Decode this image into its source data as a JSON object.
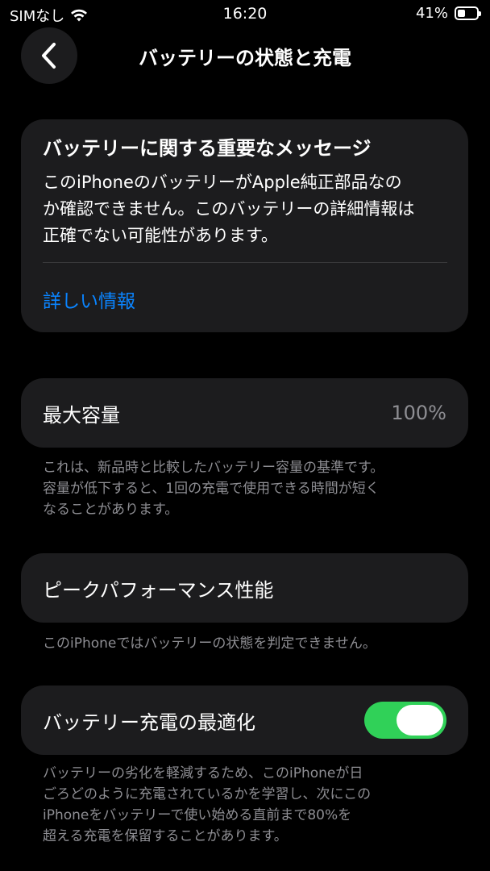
{
  "status_bar": {
    "carrier": "SIMなし",
    "time": "16:20",
    "battery_percent": "41%",
    "battery_level": 0.41
  },
  "nav": {
    "title": "バッテリーの状態と充電",
    "back_icon": "chevron-left-icon"
  },
  "message_card": {
    "title": "バッテリーに関する重要なメッセージ",
    "body_lines": [
      "このiPhoneのバッテリーがApple純正部品なの",
      "か確認できません。このバッテリーの詳細情報は",
      "正確でない可能性があります。"
    ],
    "link": "詳しい情報"
  },
  "max_capacity": {
    "label": "最大容量",
    "value": "100%",
    "note_lines": [
      "これは、新品時と比較したバッテリー容量の基準です。",
      "容量が低下すると、1回の充電で使用できる時間が短く",
      "なることがあります。"
    ]
  },
  "peak_performance": {
    "label": "ピークパフォーマンス性能",
    "note_lines": [
      "このiPhoneではバッテリーの状態を判定できません。"
    ]
  },
  "optimized_charging": {
    "label": "バッテリー充電の最適化",
    "enabled": true,
    "note_lines": [
      "バッテリーの劣化を軽減するため、このiPhoneが日",
      "ごろどのように充電されているかを学習し、次にこの",
      "iPhoneをバッテリーで使い始める直前まで80%を",
      "超える充電を保留することがあります。"
    ]
  },
  "colors": {
    "background": "#000000",
    "card": "#1c1c1e",
    "link": "#0a84ff",
    "toggle_on": "#30d158",
    "secondary_text": "#8e8e93"
  }
}
